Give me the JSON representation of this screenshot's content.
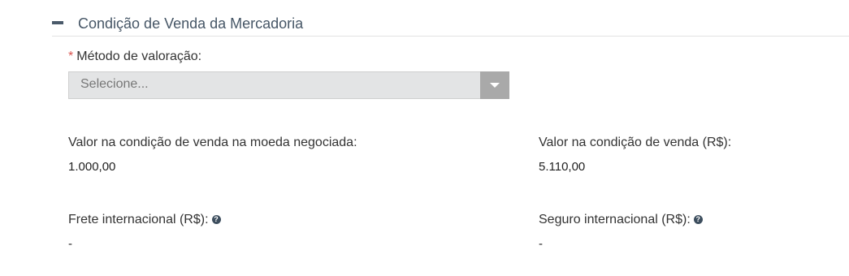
{
  "section": {
    "title": "Condição de Venda da Mercadoria"
  },
  "valuation": {
    "required_mark": "*",
    "label": "Método de valoração:",
    "placeholder": "Selecione..."
  },
  "fields": {
    "value_negotiated_label": "Valor na condição de venda na moeda negociada:",
    "value_negotiated": "1.000,00",
    "value_brl_label": "Valor na condição de venda (R$):",
    "value_brl": "5.110,00",
    "freight_label": "Frete internacional (R$):",
    "freight_value": "-",
    "insurance_label": "Seguro internacional (R$):",
    "insurance_value": "-"
  },
  "icons": {
    "help_glyph": "?",
    "collapse": "minus-icon",
    "dropdown": "chevron-down-icon",
    "help": "question-circle-icon"
  },
  "colors": {
    "title": "#465666",
    "required": "#d9534f",
    "select_bg": "#e3e4e5",
    "select_arrow_bg": "#a9a9a9"
  }
}
